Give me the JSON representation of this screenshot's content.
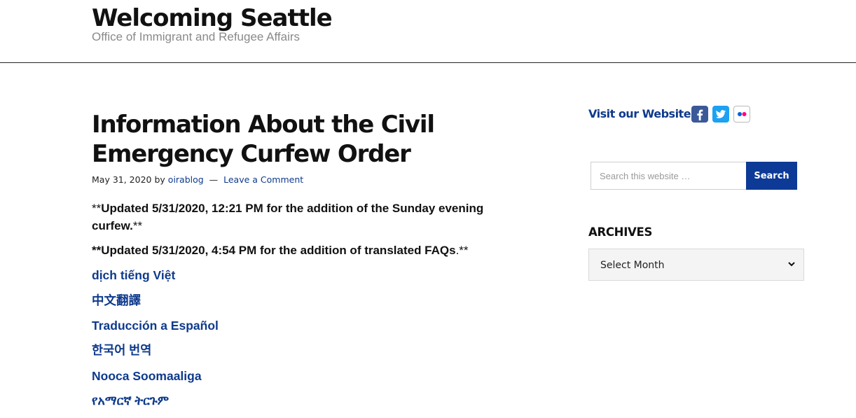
{
  "header": {
    "site_title": "Welcoming Seattle",
    "tagline": "Office of Immigrant and Refugee Affairs"
  },
  "post": {
    "title_line1": "Information About the Civil",
    "title_line2": "Emergency Curfew Order",
    "date": "May 31, 2020",
    "by": "by",
    "author": "oirablog",
    "dash": "—",
    "comment_link": "Leave a Comment",
    "update1_prefix": "**",
    "update1_text": "Updated 5/31/2020, 12:21 PM for the addition of the Sunday evening curfew.",
    "update1_suffix": "**",
    "update2_text": "**Updated 5/31/2020, 4:54 PM for the addition of translated FAQs",
    "update2_suffix": ".**",
    "languages": [
      "dịch tiếng Việt",
      "中文翻譯",
      "Traducción a Español",
      "한국어 번역",
      "Nooca Soomaaliga",
      "የአማርኛ ትርጉም"
    ]
  },
  "sidebar": {
    "visit_text": "Visit our Website",
    "social_icons": [
      "facebook-icon",
      "twitter-icon",
      "flickr-icon"
    ],
    "search_placeholder": "Search this website …",
    "search_button": "Search",
    "archives_title": "ARCHIVES",
    "archives_selected": "Select Month"
  },
  "colors": {
    "link": "#0e3a8c",
    "button": "#0d3a96",
    "tagline": "#8a8a8a"
  }
}
